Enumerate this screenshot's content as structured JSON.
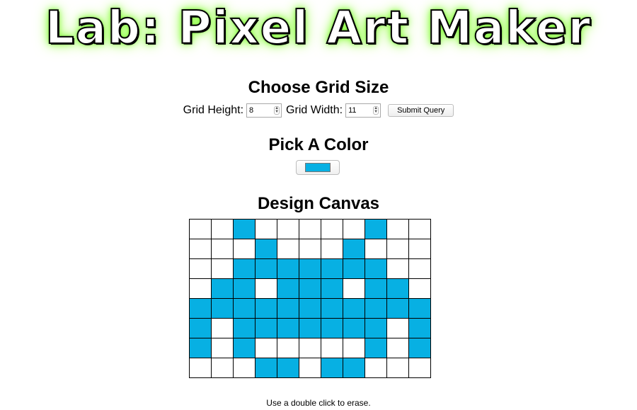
{
  "app": {
    "title": "Lab: Pixel Art Maker"
  },
  "grid_form": {
    "heading": "Choose Grid Size",
    "height_label": "Grid Height:",
    "height_value": "8",
    "width_label": "Grid Width:",
    "width_value": "11",
    "submit_label": "Submit Query"
  },
  "color_picker": {
    "heading": "Pick A Color",
    "value": "#07b0e3"
  },
  "canvas": {
    "heading": "Design Canvas",
    "rows": 8,
    "cols": 11,
    "fill_color": "#07b0e3",
    "cells": [
      [
        0,
        0,
        1,
        0,
        0,
        0,
        0,
        0,
        1,
        0,
        0
      ],
      [
        0,
        0,
        0,
        1,
        0,
        0,
        0,
        1,
        0,
        0,
        0
      ],
      [
        0,
        0,
        1,
        1,
        1,
        1,
        1,
        1,
        1,
        0,
        0
      ],
      [
        0,
        1,
        1,
        0,
        1,
        1,
        1,
        0,
        1,
        1,
        0
      ],
      [
        1,
        1,
        1,
        1,
        1,
        1,
        1,
        1,
        1,
        1,
        1
      ],
      [
        1,
        0,
        1,
        1,
        1,
        1,
        1,
        1,
        1,
        0,
        1
      ],
      [
        1,
        0,
        1,
        0,
        0,
        0,
        0,
        0,
        1,
        0,
        1
      ],
      [
        0,
        0,
        0,
        1,
        1,
        0,
        1,
        1,
        0,
        0,
        0
      ]
    ],
    "hint": "Use a double click to erase."
  }
}
